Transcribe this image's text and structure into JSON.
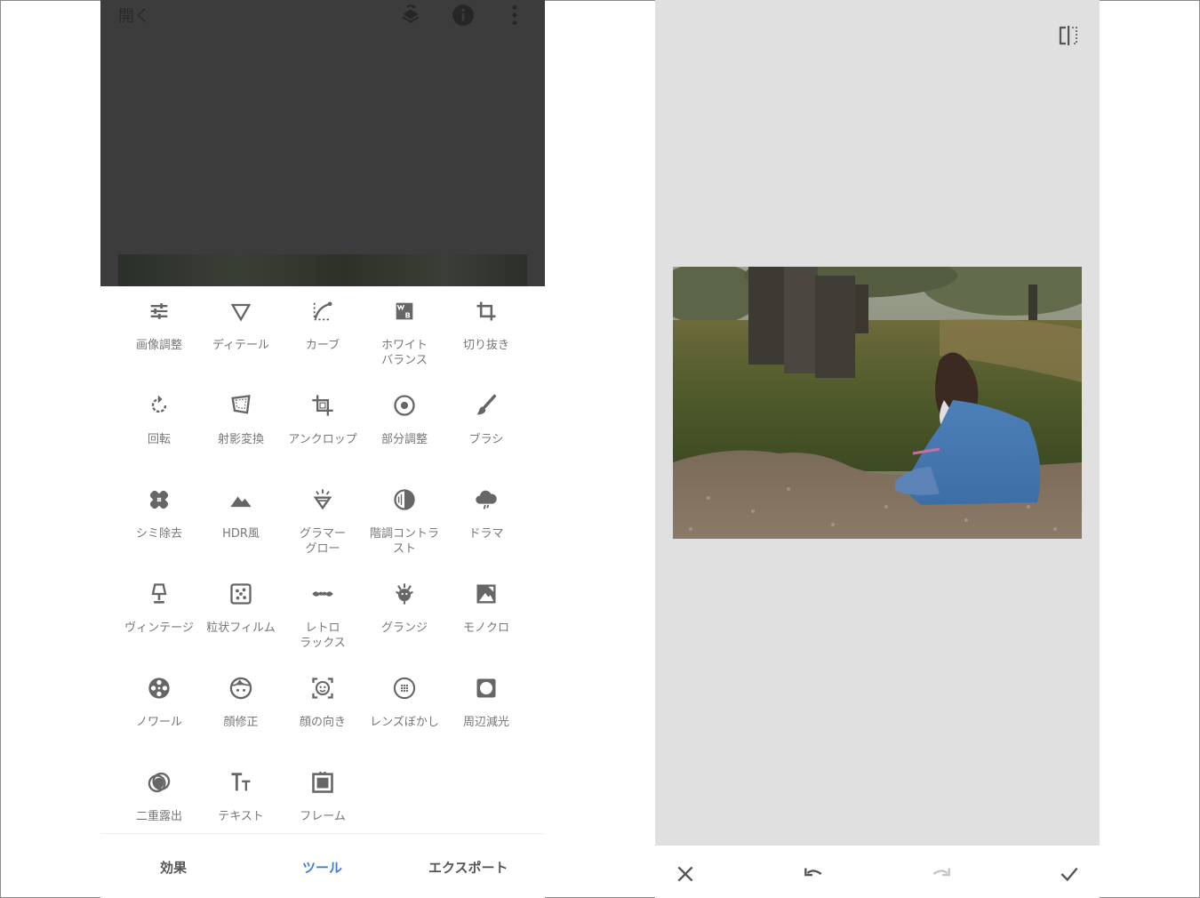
{
  "left_screen": {
    "header": {
      "open_label": "開く",
      "icons": [
        "layers-undo-icon",
        "info-icon",
        "more-vert-icon"
      ]
    },
    "tools": [
      {
        "label": "画像調整",
        "icon": "tune-icon"
      },
      {
        "label": "ディテール",
        "icon": "details-triangle-icon"
      },
      {
        "label": "カーブ",
        "icon": "curves-icon"
      },
      {
        "label": "ホワイト\nバランス",
        "icon": "white-balance-icon"
      },
      {
        "label": "切り抜き",
        "icon": "crop-icon"
      },
      {
        "label": "回転",
        "icon": "rotate-icon"
      },
      {
        "label": "射影変換",
        "icon": "perspective-icon"
      },
      {
        "label": "アンクロップ",
        "icon": "expand-icon"
      },
      {
        "label": "部分調整",
        "icon": "selective-icon"
      },
      {
        "label": "ブラシ",
        "icon": "brush-icon"
      },
      {
        "label": "シミ除去",
        "icon": "healing-icon"
      },
      {
        "label": "HDR風",
        "icon": "hdr-mountain-icon"
      },
      {
        "label": "グラマー\nグロー",
        "icon": "glamour-glow-icon"
      },
      {
        "label": "階調コントラ\nスト",
        "icon": "tonal-contrast-icon"
      },
      {
        "label": "ドラマ",
        "icon": "drama-cloud-icon"
      },
      {
        "label": "ヴィンテージ",
        "icon": "vintage-lamp-icon"
      },
      {
        "label": "粒状フィルム",
        "icon": "grainy-film-icon"
      },
      {
        "label": "レトロ\nラックス",
        "icon": "retrolux-mustache-icon"
      },
      {
        "label": "グランジ",
        "icon": "grunge-icon"
      },
      {
        "label": "モノクロ",
        "icon": "black-white-icon"
      },
      {
        "label": "ノワール",
        "icon": "noir-film-reel-icon"
      },
      {
        "label": "顔修正",
        "icon": "face-enhance-icon"
      },
      {
        "label": "顔の向き",
        "icon": "head-pose-icon"
      },
      {
        "label": "レンズぼかし",
        "icon": "lens-blur-icon"
      },
      {
        "label": "周辺減光",
        "icon": "vignette-icon"
      },
      {
        "label": "二重露出",
        "icon": "double-exposure-icon"
      },
      {
        "label": "テキスト",
        "icon": "text-icon"
      },
      {
        "label": "フレーム",
        "icon": "frame-icon"
      }
    ],
    "bottom_nav": {
      "tabs": [
        {
          "label": "効果",
          "active": false
        },
        {
          "label": "ツール",
          "active": true
        },
        {
          "label": "エクスポート",
          "active": false
        }
      ]
    }
  },
  "right_screen": {
    "top_icon": "compare-split-icon",
    "actions": [
      "close-icon",
      "undo-icon",
      "redo-icon",
      "check-icon"
    ]
  },
  "colors": {
    "accent": "#3f7ed8",
    "dark_header": "#3c3c3c",
    "canvas_bg": "#e0e0e0",
    "icon_gray": "#666666"
  }
}
